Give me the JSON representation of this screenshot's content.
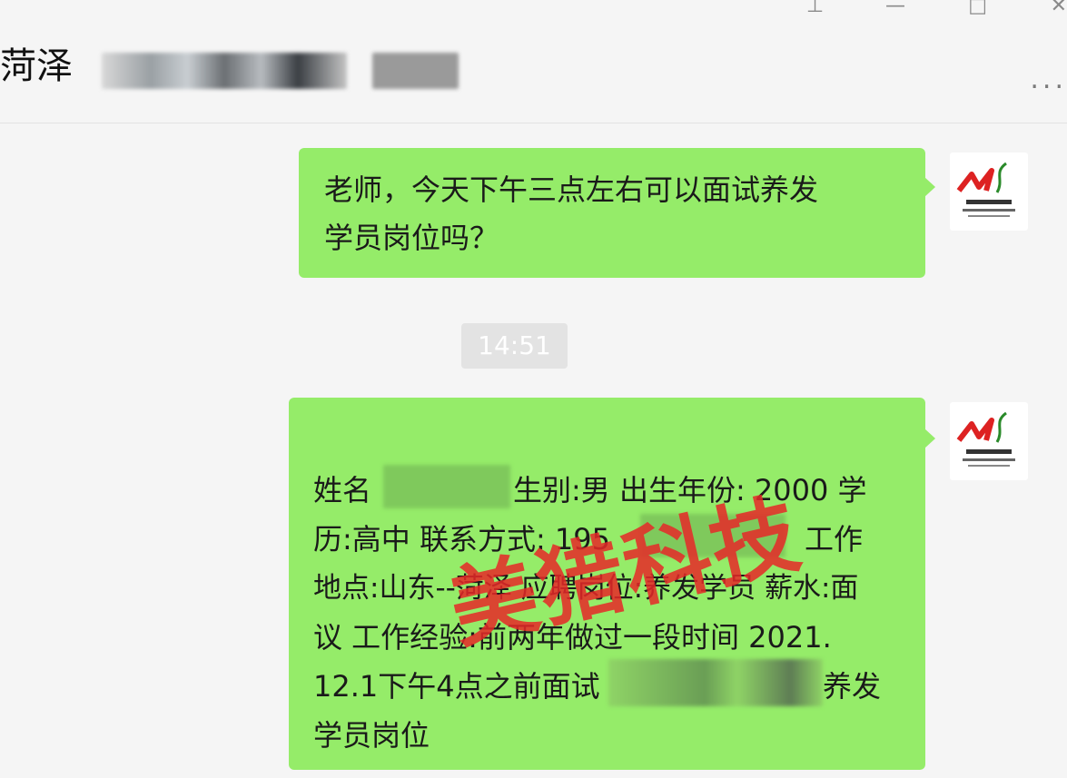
{
  "header": {
    "title": "菏泽",
    "more_label": "..."
  },
  "window_controls": {
    "pin_icon": "pin-icon",
    "minimize_icon": "minimize-icon",
    "maximize_icon": "maximize-icon",
    "close_icon": "close-icon"
  },
  "messages": [
    {
      "text": "老师，今天下午三点左右可以面试养发学员岗位吗？",
      "lines": [
        "老师，今天下午三点左右可以面试养发",
        "学员岗位吗？"
      ]
    },
    {
      "text": "姓名 生别:男 出生年份: 2000 学历:高中 联系方式: 195 工作地点:山东--菏泽 应聘岗位:养发学员 薪水:面议 工作经验:前两年做过一段时间 2021.12.1下午4点之前面试 养发学员岗位",
      "lines": [
        "姓名",
        "生别:男 出生年份: 2000 学",
        "历:高中 联系方式: 195",
        "工作",
        "地点:山东--菏泽 应聘岗位:养发学员 薪水:面",
        "议 工作经验:前两年做过一段时间 2021.",
        "12.1下午4点之前面试",
        "养发",
        "学员岗位"
      ]
    }
  ],
  "timestamp": "14:51",
  "watermark": "美猎科技",
  "colors": {
    "bubble": "#95ec69",
    "background": "#f5f5f5",
    "watermark": "#e62828"
  }
}
